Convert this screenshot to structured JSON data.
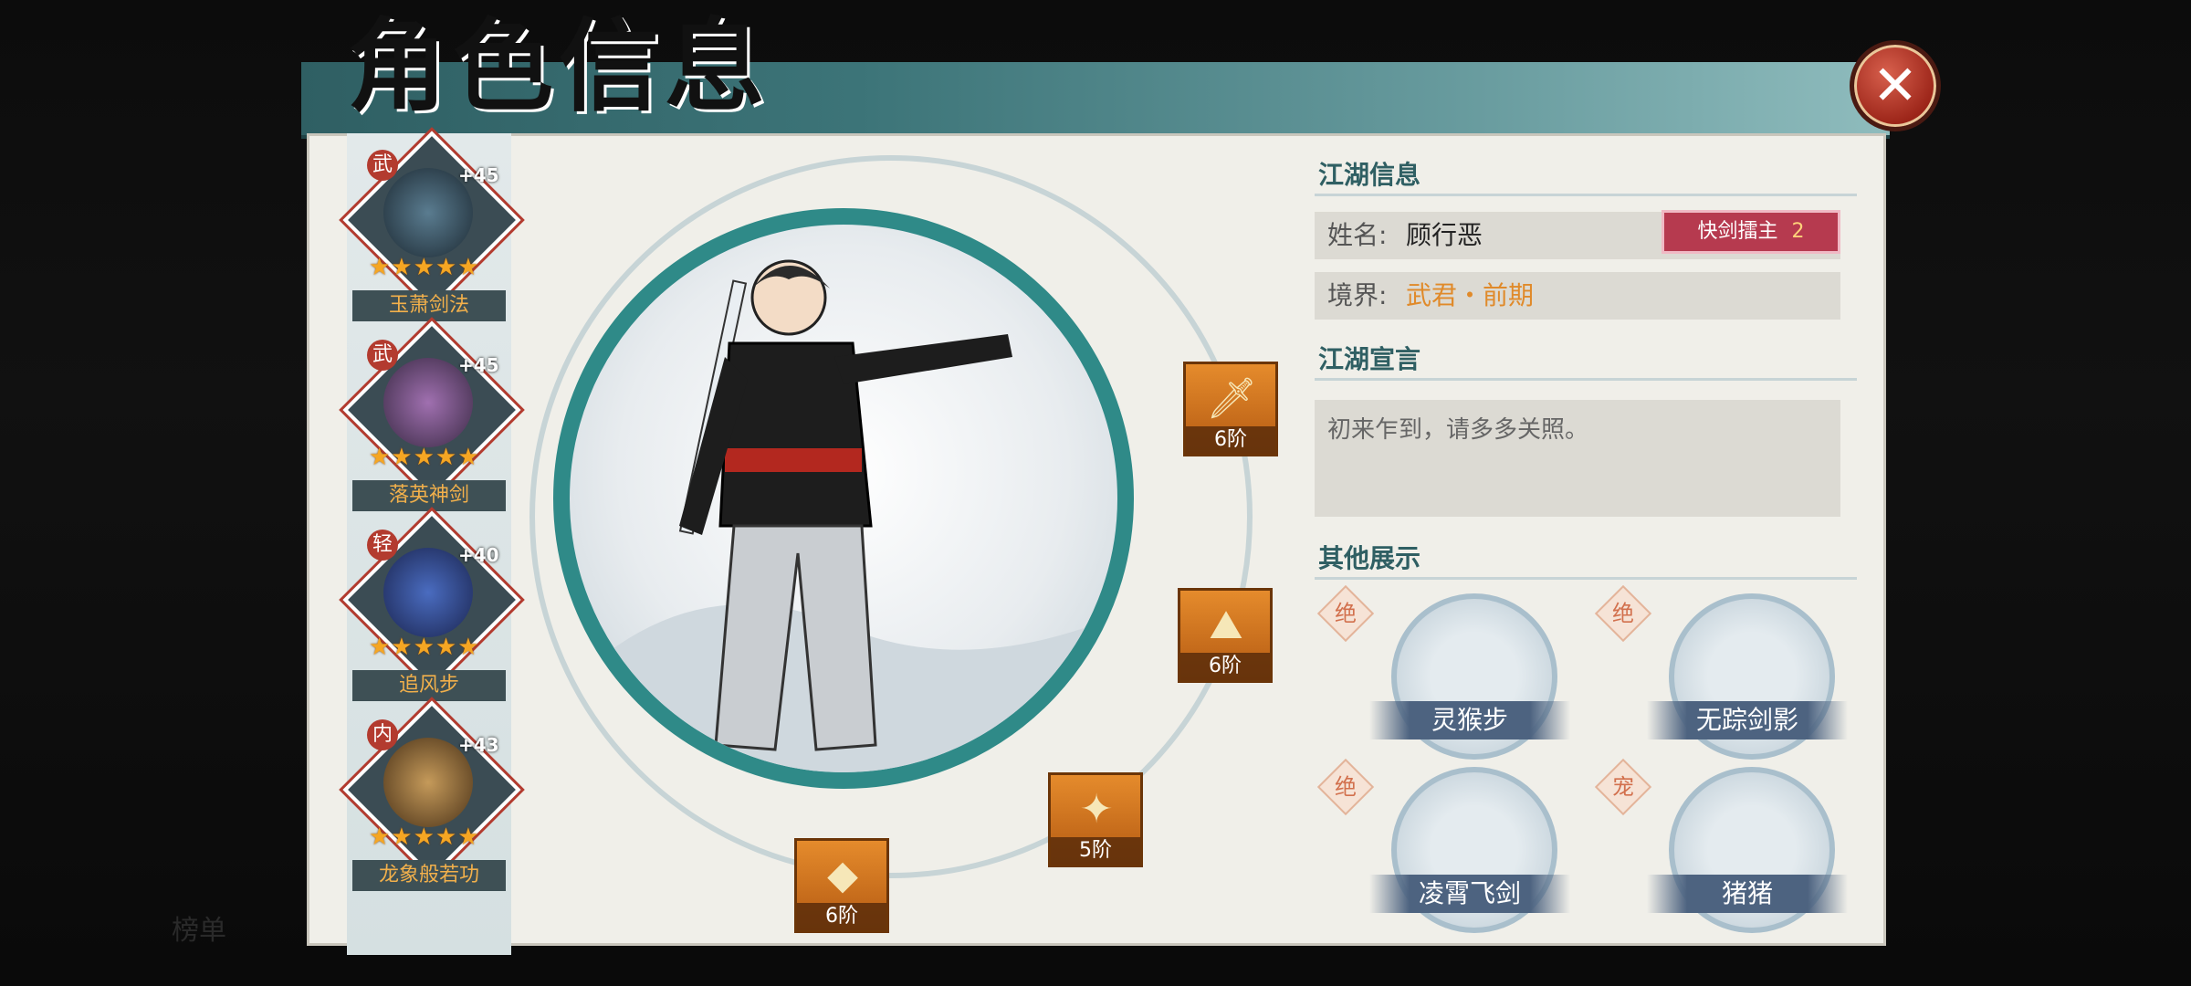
{
  "window": {
    "title": "角色信息",
    "close_label": "✕"
  },
  "skills": [
    {
      "type": "武",
      "bonus": "+45",
      "stars": "★★★★★",
      "name": "玉萧剑法"
    },
    {
      "type": "武",
      "bonus": "+45",
      "stars": "★★★★★",
      "name": "落英神剑"
    },
    {
      "type": "轻",
      "bonus": "+40",
      "stars": "★★★★★",
      "name": "追风步"
    },
    {
      "type": "内",
      "bonus": "+43",
      "stars": "★★★★★",
      "name": "龙象般若功"
    }
  ],
  "equipment": [
    {
      "icon": "sword-icon",
      "level": "6阶"
    },
    {
      "icon": "hat-icon",
      "level": "6阶"
    },
    {
      "icon": "armor-icon",
      "level": "5阶"
    },
    {
      "icon": "boots-icon",
      "level": "6阶"
    }
  ],
  "info": {
    "section_title": "江湖信息",
    "name_label": "姓名:",
    "name_value": "顾行恶",
    "badge_label": "快剑擂主",
    "badge_num": "2",
    "realm_label": "境界:",
    "realm_value": "武君・前期",
    "realm_color": "#e08a2a"
  },
  "manifesto": {
    "section_title": "江湖宣言",
    "text": "初来乍到，请多多关照。"
  },
  "showcase": {
    "section_title": "其他展示",
    "items": [
      {
        "grade": "绝",
        "name": "灵猴步"
      },
      {
        "grade": "绝",
        "name": "无踪剑影"
      },
      {
        "grade": "绝",
        "name": "凌霄飞剑"
      },
      {
        "grade": "宠",
        "name": "猪猪"
      }
    ]
  },
  "background": {
    "ghost_label": "榜单"
  }
}
